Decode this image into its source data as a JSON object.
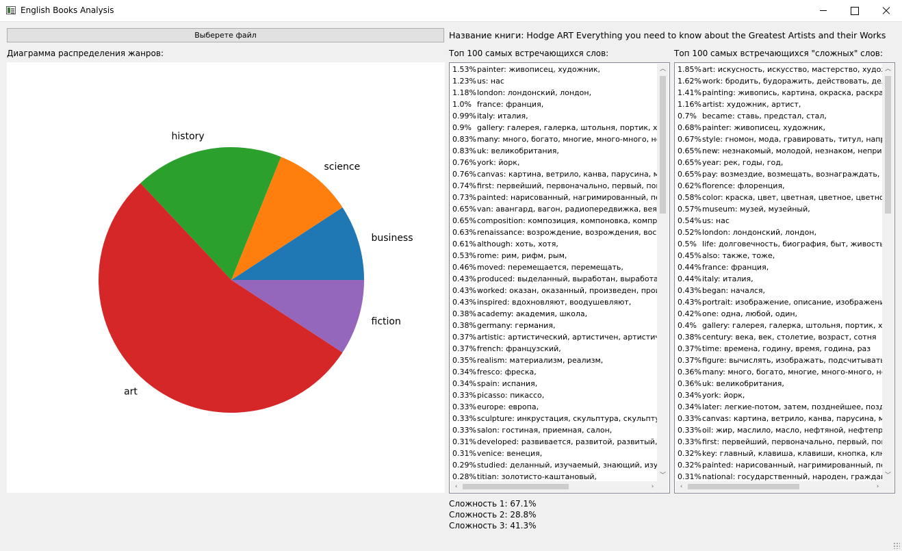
{
  "window": {
    "title": "English Books Analysis",
    "icon": "app-window-icon"
  },
  "toolbar": {
    "file_button_label": "Выберете файл"
  },
  "book": {
    "title_text": "Название книги: Hodge ART Everything you need to know about the Greatest Artists and their Works"
  },
  "genre_chart_label": "Диаграмма распределения жанров:",
  "chart_data": {
    "type": "pie",
    "categories": [
      "business",
      "science",
      "history",
      "art",
      "fiction"
    ],
    "values": [
      9.2,
      9.7,
      18.1,
      53.8,
      9.2
    ],
    "colors": [
      "#1f77b4",
      "#ff7f0e",
      "#2ca02c",
      "#d62728",
      "#9467bd"
    ],
    "start_angle_deg": 0,
    "direction": "counterclockwise",
    "legend": "labels outside slices"
  },
  "top_words": {
    "label": "Топ 100 самых встречающихся слов:",
    "items": [
      {
        "pct": "1.53%",
        "text": "painter: живописец, художник,"
      },
      {
        "pct": "1.23%",
        "text": "us: нас"
      },
      {
        "pct": "1.18%",
        "text": "london: лондонский, лондон,"
      },
      {
        "pct": "1.0%",
        "text": "france: франция,"
      },
      {
        "pct": "0.99%",
        "text": "italy: италия,"
      },
      {
        "pct": "0.9%",
        "text": "gallery: галерея, галерка, штольня, портик, хорь"
      },
      {
        "pct": "0.83%",
        "text": "many: много, богато, многие, много-много, не"
      },
      {
        "pct": "0.83%",
        "text": "uk: великобритания,"
      },
      {
        "pct": "0.76%",
        "text": "york: йорк,"
      },
      {
        "pct": "0.76%",
        "text": "canvas: картина, ветрило, канва, парусина, мар."
      },
      {
        "pct": "0.74%",
        "text": "first: первейший, первоначально, первый, пона"
      },
      {
        "pct": "0.73%",
        "text": "painted: нарисованный, нагримированный, пес"
      },
      {
        "pct": "0.65%",
        "text": "van: авангард, вагон, радиопередвижка, веялка,"
      },
      {
        "pct": "0.65%",
        "text": "composition: композиция, компоновка, компрс"
      },
      {
        "pct": "0.63%",
        "text": "renaissance: возрождение, возрождения, воскре"
      },
      {
        "pct": "0.61%",
        "text": "although: хоть, хотя,"
      },
      {
        "pct": "0.53%",
        "text": "rome: рим, рифм, рым,"
      },
      {
        "pct": "0.46%",
        "text": "moved: перемещается, перемещать,"
      },
      {
        "pct": "0.43%",
        "text": "produced: выделанный, выработан, выработанн"
      },
      {
        "pct": "0.43%",
        "text": "worked: оказан, оказанный, произведен, произв"
      },
      {
        "pct": "0.43%",
        "text": "inspired: вдохновляют, воодушевляют,"
      },
      {
        "pct": "0.38%",
        "text": "academy: академия, школа,"
      },
      {
        "pct": "0.38%",
        "text": "germany: германия,"
      },
      {
        "pct": "0.37%",
        "text": "artistic: артистический, артистичен, артистичнь"
      },
      {
        "pct": "0.37%",
        "text": "french: французский,"
      },
      {
        "pct": "0.35%",
        "text": "realism: материализм, реализм,"
      },
      {
        "pct": "0.34%",
        "text": "fresco: фреска,"
      },
      {
        "pct": "0.34%",
        "text": "spain: испания,"
      },
      {
        "pct": "0.33%",
        "text": "picasso: пикассо,"
      },
      {
        "pct": "0.33%",
        "text": "europe: европа,"
      },
      {
        "pct": "0.33%",
        "text": "sculpture: инкрустация, скульптура, скульптурн"
      },
      {
        "pct": "0.33%",
        "text": "salon: гостиная, приемная, салон,"
      },
      {
        "pct": "0.31%",
        "text": "developed: развивается, развитой, развитый,"
      },
      {
        "pct": "0.31%",
        "text": "venice: венеция,"
      },
      {
        "pct": "0.29%",
        "text": "studied: деланный, изучаемый, знающий, изучег"
      },
      {
        "pct": "0.28%",
        "text": "titian: золотисто-каштановый,"
      }
    ]
  },
  "top_hard_words": {
    "label": "Топ 100 самых встречающихся \"сложных\" слов:",
    "items": [
      {
        "pct": "1.85%",
        "text": "art: искусность, искусство, мастерство, художес"
      },
      {
        "pct": "1.62%",
        "text": "work: бродить, будоражить, действовать, делать"
      },
      {
        "pct": "1.41%",
        "text": "painting: живопись, картина, окраска, раскраши"
      },
      {
        "pct": "1.16%",
        "text": "artist: художник, артист,"
      },
      {
        "pct": "0.7%",
        "text": "became: ставь, предстал, стал,"
      },
      {
        "pct": "0.68%",
        "text": "painter: живописец, художник,"
      },
      {
        "pct": "0.67%",
        "text": "style: гномон, мода, гравировать, титул, направ"
      },
      {
        "pct": "0.65%",
        "text": "new: незнакомый, молодой, незнаком, непривы"
      },
      {
        "pct": "0.65%",
        "text": "year: рек, годы, год,"
      },
      {
        "pct": "0.65%",
        "text": "pay: возмездие, возмещать, вознаграждать, возі"
      },
      {
        "pct": "0.62%",
        "text": "florence: флоренция,"
      },
      {
        "pct": "0.58%",
        "text": "color: краска, цвет, цветная, цветное, цветной"
      },
      {
        "pct": "0.57%",
        "text": "museum: музей, музейный,"
      },
      {
        "pct": "0.54%",
        "text": "us: нас"
      },
      {
        "pct": "0.52%",
        "text": "london: лондонский, лондон,"
      },
      {
        "pct": "0.5%",
        "text": "life: долговечность, биография, быт, живость, ж"
      },
      {
        "pct": "0.45%",
        "text": "also: также, тоже,"
      },
      {
        "pct": "0.44%",
        "text": "france: франция,"
      },
      {
        "pct": "0.44%",
        "text": "italy: италия,"
      },
      {
        "pct": "0.43%",
        "text": "began: начался,"
      },
      {
        "pct": "0.43%",
        "text": "portrait: изображение, описание, изображения,"
      },
      {
        "pct": "0.42%",
        "text": "one: одна, любой, один,"
      },
      {
        "pct": "0.4%",
        "text": "gallery: галерея, галерка, штольня, портик, хорь"
      },
      {
        "pct": "0.38%",
        "text": "century: века, век, столетие, возраст, сотня"
      },
      {
        "pct": "0.37%",
        "text": "time: времена, годину, время, година, раз"
      },
      {
        "pct": "0.37%",
        "text": "figure: вычислять, изображать, подсчитывать, р"
      },
      {
        "pct": "0.36%",
        "text": "many: много, богато, многие, много-много, не"
      },
      {
        "pct": "0.36%",
        "text": "uk: великобритания,"
      },
      {
        "pct": "0.34%",
        "text": "york: йорк,"
      },
      {
        "pct": "0.34%",
        "text": "later: легкие-потом, затем, позднейшее, поздне"
      },
      {
        "pct": "0.33%",
        "text": "canvas: картина, ветрило, канва, парусина, мар."
      },
      {
        "pct": "0.33%",
        "text": "oil: жир, маслило, масло, нефтяной, нефтепрод"
      },
      {
        "pct": "0.33%",
        "text": "first: первейший, первоначально, первый, пона"
      },
      {
        "pct": "0.32%",
        "text": "key: главный, клавиша, клавиши, кнопка, ключ"
      },
      {
        "pct": "0.32%",
        "text": "painted: нарисованный, нагримированный, пес"
      },
      {
        "pct": "0.31%",
        "text": "national: государственный, народен, гражданин"
      }
    ]
  },
  "stats": {
    "line1": "Сложность 1: 67.1%",
    "line2": "Сложность 2: 28.8%",
    "line3": "Сложность 3: 41.3%"
  }
}
